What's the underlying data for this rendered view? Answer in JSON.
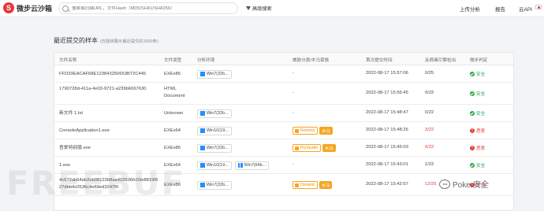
{
  "header": {
    "logo_text": "微步云沙箱",
    "search_placeholder": "搜索或扫描URL，文件Hash（MD5/SHA1/SHA256）",
    "advanced_search": "高级搜索",
    "nav": [
      "上传分析",
      "报告",
      "云API"
    ]
  },
  "section": {
    "title": "最近提交的样本",
    "subtitle": "(仅能转展示最近提交的1000条)"
  },
  "table": {
    "columns": [
      "文件名称",
      "文件类型",
      "分析环境",
      "威胁分类/木马家族",
      "首次提交时间",
      "反病毒引擎检出",
      "微步判定"
    ],
    "rows": [
      {
        "name": "FFD33EACAF68E123843250653B72C445",
        "type": "EXEx86",
        "env": [
          "Win7(32b..."
        ],
        "family": "",
        "threat_type": "",
        "time": "2022-08-17 15:57:06",
        "ratio": "0/25",
        "verdict": "安全",
        "bad": false
      },
      {
        "name": "1790728d-411a-4e03-9721-a239b6067630",
        "type": "HTML Document",
        "env": [],
        "family": "",
        "threat_type": "",
        "time": "2022-08-17 15:56:45",
        "ratio": "0/22",
        "verdict": "安全",
        "bad": false
      },
      {
        "name": "新文件 1.txt",
        "type": "Unknown",
        "env": [
          "Win7(32b..."
        ],
        "family": "",
        "threat_type": "",
        "time": "2022-08-17 15:48:47",
        "ratio": "0/22",
        "verdict": "安全",
        "bad": false
      },
      {
        "name": "ConsoleApplication1.exe",
        "type": "EXEx64",
        "env": [
          "Win10(19..."
        ],
        "family": "Rozena",
        "threat_type": "木马",
        "time": "2022-08-17 15:48:26",
        "ratio": "3/22",
        "verdict": "恶意",
        "bad": true
      },
      {
        "name": "吾爱特别版.exe",
        "type": "EXEx86",
        "env": [
          "Win7(32b..."
        ],
        "family": "FlyStudio",
        "threat_type": "木马",
        "time": "2022-08-17 15:45:03",
        "ratio": "6/22",
        "verdict": "恶意",
        "bad": true
      },
      {
        "name": "1.exe",
        "type": "EXEx64",
        "env": [
          "Win10(19...",
          "Win7(64b..."
        ],
        "family": "",
        "threat_type": "",
        "time": "2022-08-17 15:43:01",
        "ratio": "1/22",
        "verdict": "安全",
        "bad": false
      },
      {
        "name": "4c672ab64eb2eb98122b8aa415536fc03e8819f927dbb4c0536c4e69ed3247f0",
        "type": "EXEx86",
        "env": [
          "Win7(32b..."
        ],
        "family": "Dinwod",
        "threat_type": "木马",
        "time": "2022-08-17 15:42:57",
        "ratio": "12/25",
        "verdict": "恶意",
        "bad": true
      }
    ]
  },
  "watermark": {
    "text": "FREEBUF",
    "badge": "Poker安全"
  }
}
